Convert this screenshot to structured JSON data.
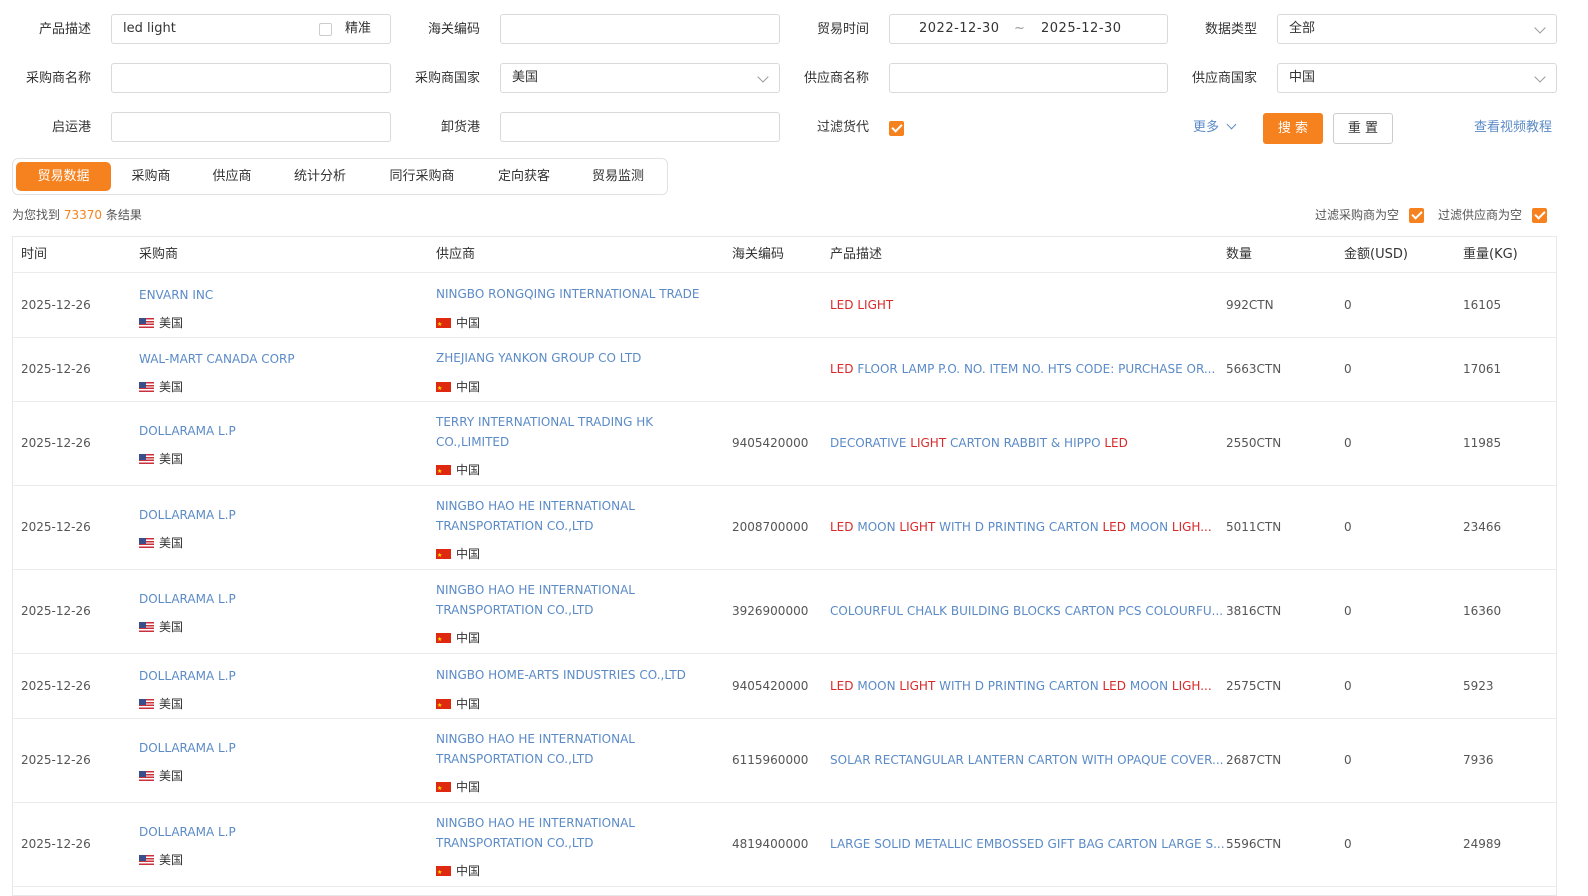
{
  "filters": {
    "product_desc_label": "产品描述",
    "product_desc_value": "led light",
    "exact_label": "精准",
    "hs_code_label": "海关编码",
    "trade_time_label": "贸易时间",
    "date_from": "2022-12-30",
    "date_sep": "~",
    "date_to": "2025-12-30",
    "data_type_label": "数据类型",
    "data_type_value": "全部",
    "buyer_name_label": "采购商名称",
    "buyer_country_label": "采购商国家",
    "buyer_country_value": "美国",
    "supplier_name_label": "供应商名称",
    "supplier_country_label": "供应商国家",
    "supplier_country_value": "中国",
    "origin_port_label": "启运港",
    "dest_port_label": "卸货港",
    "filter_forwarder_label": "过滤货代",
    "more_label": "更多",
    "search_label": "搜 索",
    "reset_label": "重 置",
    "video_tutorial_label": "查看视频教程"
  },
  "tabs": [
    "贸易数据",
    "采购商",
    "供应商",
    "统计分析",
    "同行采购商",
    "定向获客",
    "贸易监测"
  ],
  "results": {
    "prefix": "为您找到",
    "count": "73370",
    "suffix": "条结果",
    "filter_buyer_empty": "过滤采购商为空",
    "filter_supplier_empty": "过滤供应商为空"
  },
  "table": {
    "headers": {
      "time": "时间",
      "buyer": "采购商",
      "supplier": "供应商",
      "hs_code": "海关编码",
      "desc": "产品描述",
      "qty": "数量",
      "amount": "金额(USD)",
      "weight": "重量(KG)"
    },
    "rows": [
      {
        "time": "2025-12-26",
        "buyer": "ENVARN INC",
        "buyer_country": "美国",
        "supplier": "NINGBO RONGQING INTERNATIONAL TRADE",
        "supplier_country": "中国",
        "hs_code": "",
        "desc": "LED LIGHT",
        "qty": "992CTN",
        "amount": "0",
        "weight": "16105"
      },
      {
        "time": "2025-12-26",
        "buyer": "WAL-MART CANADA CORP",
        "buyer_country": "美国",
        "supplier": "ZHEJIANG YANKON GROUP CO LTD",
        "supplier_country": "中国",
        "hs_code": "",
        "desc": "LED FLOOR LAMP P.O. NO. ITEM NO. HTS CODE: PURCHASE OR...",
        "qty": "5663CTN",
        "amount": "0",
        "weight": "17061"
      },
      {
        "time": "2025-12-26",
        "buyer": "DOLLARAMA L.P",
        "buyer_country": "美国",
        "supplier": "TERRY INTERNATIONAL TRADING HK CO.,LIMITED",
        "supplier_country": "中国",
        "hs_code": "9405420000",
        "desc": "DECORATIVE LIGHT CARTON RABBIT & HIPPO LED",
        "qty": "2550CTN",
        "amount": "0",
        "weight": "11985"
      },
      {
        "time": "2025-12-26",
        "buyer": "DOLLARAMA L.P",
        "buyer_country": "美国",
        "supplier": "NINGBO HAO HE INTERNATIONAL TRANSPORTATION CO.,LTD",
        "supplier_country": "中国",
        "hs_code": "2008700000",
        "desc": "LED MOON LIGHT WITH D PRINTING CARTON LED MOON LIGH...",
        "qty": "5011CTN",
        "amount": "0",
        "weight": "23466"
      },
      {
        "time": "2025-12-26",
        "buyer": "DOLLARAMA L.P",
        "buyer_country": "美国",
        "supplier": "NINGBO HAO HE INTERNATIONAL TRANSPORTATION CO.,LTD",
        "supplier_country": "中国",
        "hs_code": "3926900000",
        "desc": "COLOURFUL CHALK BUILDING BLOCKS CARTON PCS COLOURFU...",
        "qty": "3816CTN",
        "amount": "0",
        "weight": "16360"
      },
      {
        "time": "2025-12-26",
        "buyer": "DOLLARAMA L.P",
        "buyer_country": "美国",
        "supplier": "NINGBO HOME-ARTS INDUSTRIES CO.,LTD",
        "supplier_country": "中国",
        "hs_code": "9405420000",
        "desc": "LED MOON LIGHT WITH D PRINTING CARTON LED MOON LIGH...",
        "qty": "2575CTN",
        "amount": "0",
        "weight": "5923"
      },
      {
        "time": "2025-12-26",
        "buyer": "DOLLARAMA L.P",
        "buyer_country": "美国",
        "supplier": "NINGBO HAO HE INTERNATIONAL TRANSPORTATION CO.,LTD",
        "supplier_country": "中国",
        "hs_code": "6115960000",
        "desc": "SOLAR RECTANGULAR LANTERN CARTON WITH OPAQUE COVER...",
        "qty": "2687CTN",
        "amount": "0",
        "weight": "7936"
      },
      {
        "time": "2025-12-26",
        "buyer": "DOLLARAMA L.P",
        "buyer_country": "美国",
        "supplier": "NINGBO HAO HE INTERNATIONAL TRANSPORTATION CO.,LTD",
        "supplier_country": "中国",
        "hs_code": "4819400000",
        "desc": "LARGE SOLID METALLIC EMBOSSED GIFT BAG CARTON LARGE S...",
        "qty": "5596CTN",
        "amount": "0",
        "weight": "24989"
      }
    ]
  },
  "colors": {
    "accent": "#f5821f",
    "link": "#5b8bc7",
    "highlight": "#d9292a"
  }
}
